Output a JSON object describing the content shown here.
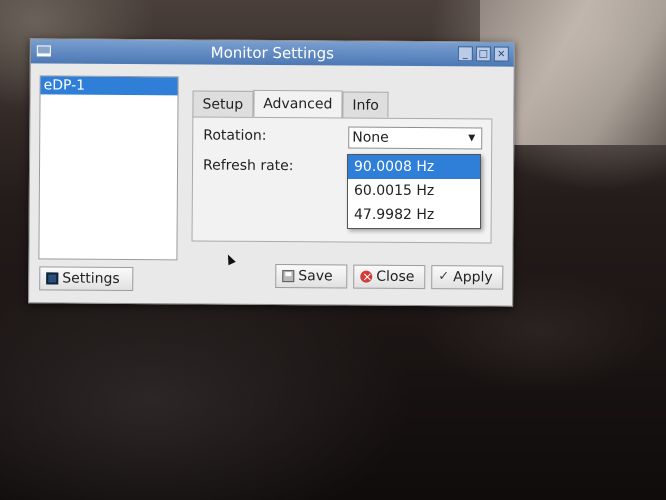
{
  "window": {
    "title": "Monitor Settings",
    "controls": [
      "_",
      "□",
      "×"
    ]
  },
  "display_list": {
    "items": [
      "eDP-1"
    ],
    "selected": "eDP-1"
  },
  "tabs": [
    "Setup",
    "Advanced",
    "Info"
  ],
  "active_tab": "Advanced",
  "advanced": {
    "rotation_label": "Rotation:",
    "rotation_value": "None",
    "refresh_label": "Refresh rate:",
    "refresh_options": [
      "90.0008 Hz",
      "60.0015 Hz",
      "47.9982 Hz"
    ],
    "refresh_selected": "90.0008 Hz"
  },
  "buttons": {
    "settings": "Settings",
    "save": "Save",
    "close": "Close",
    "apply": "Apply"
  },
  "colors": {
    "titlebar": "#4c78b4",
    "selection": "#2f7fd8"
  }
}
